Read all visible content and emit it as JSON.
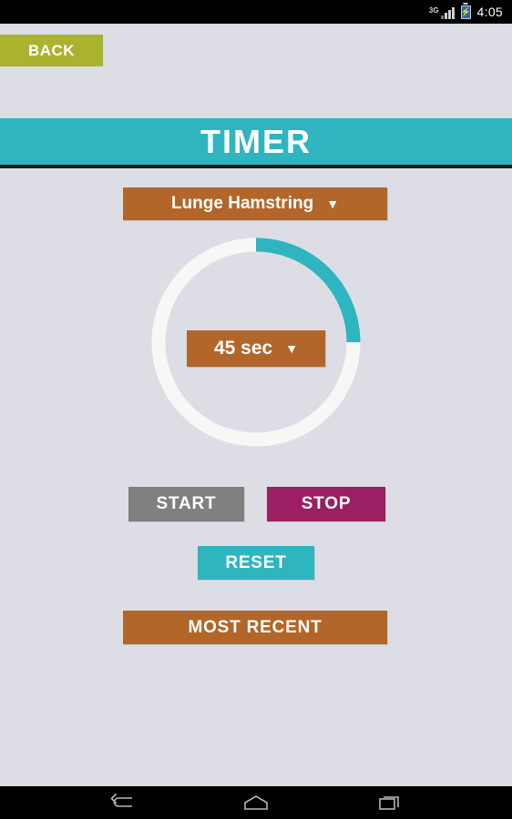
{
  "status_bar": {
    "network_label": "3G",
    "signal_icon": "signal-bars-icon",
    "battery_icon": "battery-charging-icon",
    "battery_glyph": "⚡",
    "time": "4:05"
  },
  "header": {
    "back_label": "BACK",
    "title": "TIMER"
  },
  "exercise": {
    "selected": "Lunge Hamstring",
    "caret": "▼"
  },
  "timer": {
    "duration_label": "45 sec",
    "caret": "▼",
    "progress_percent": 25,
    "ring_track_color": "#f7f7f7",
    "ring_progress_color": "#2fb5bf"
  },
  "controls": {
    "start_label": "START",
    "stop_label": "STOP",
    "reset_label": "RESET",
    "most_recent_label": "MOST RECENT"
  },
  "colors": {
    "background": "#dddde5",
    "teal": "#2fb5bf",
    "brown": "#b2662a",
    "olive": "#aab22e",
    "magenta": "#9c1e63",
    "gray": "#808080"
  },
  "nav_bar": {
    "back_icon": "nav-back-icon",
    "home_icon": "nav-home-icon",
    "recents_icon": "nav-recents-icon"
  }
}
